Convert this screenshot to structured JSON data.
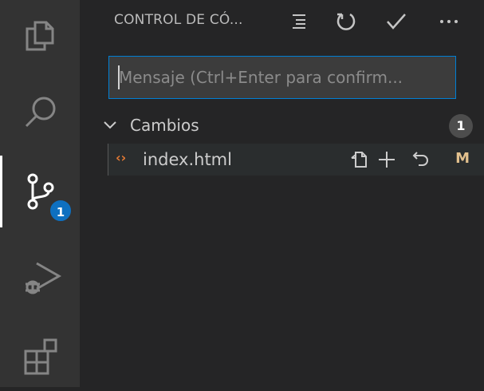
{
  "activity_bar": {
    "items": [
      {
        "name": "explorer",
        "icon": "files-icon"
      },
      {
        "name": "search",
        "icon": "search-icon"
      },
      {
        "name": "source-control",
        "icon": "source-control-icon",
        "badge": "1",
        "active": true
      },
      {
        "name": "run-debug",
        "icon": "run-debug-icon"
      },
      {
        "name": "extensions",
        "icon": "extensions-icon"
      }
    ]
  },
  "panel": {
    "title": "CONTROL DE CÓ...",
    "actions": [
      "tree-view-icon",
      "refresh-icon",
      "commit-check-icon",
      "more-actions-icon"
    ],
    "message_input": {
      "value": "",
      "placeholder": "Mensaje (Ctrl+Enter para confirm..."
    },
    "changes_group": {
      "label": "Cambios",
      "count": "1",
      "files": [
        {
          "name": "index.html",
          "icon": "html-file-icon",
          "status": "M",
          "actions": [
            "open-file-icon",
            "stage-plus-icon",
            "discard-changes-icon"
          ]
        }
      ]
    }
  },
  "colors": {
    "activity_bg": "#333333",
    "panel_bg": "#252526",
    "accent_blue": "#0e70c0",
    "focus_border": "#007fd4",
    "modified": "#e2c08d",
    "html_icon": "#e37933"
  }
}
